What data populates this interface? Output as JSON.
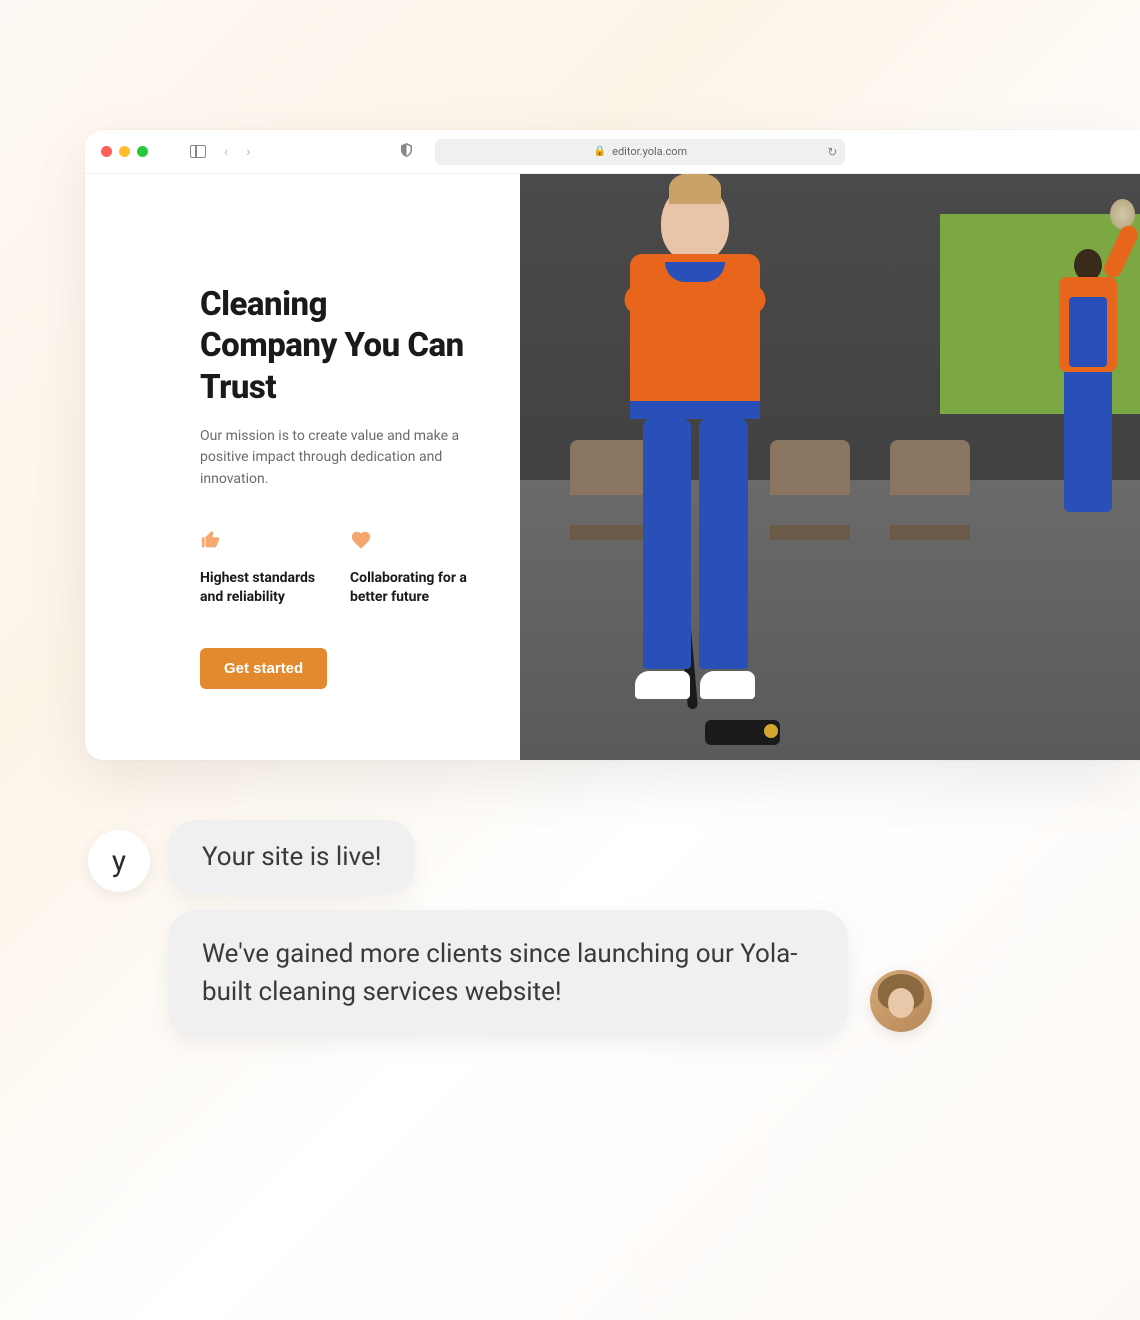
{
  "browser": {
    "url": "editor.yola.com"
  },
  "page": {
    "hero_title": "Cleaning Company You Can Trust",
    "hero_subtitle": "Our mission is to create value and make a positive impact through dedication and innovation.",
    "features": [
      {
        "text": "Highest standards and reliability"
      },
      {
        "text": "Collaborating for a better future"
      }
    ],
    "cta_label": "Get started"
  },
  "chat": {
    "yola_avatar_letter": "y",
    "bubble1": "Your site is live!",
    "bubble2": "We've gained more clients since launching our Yola-built cleaning services website!"
  },
  "colors": {
    "accent": "#e38a2e",
    "feature_icon": "#f5a76d"
  }
}
